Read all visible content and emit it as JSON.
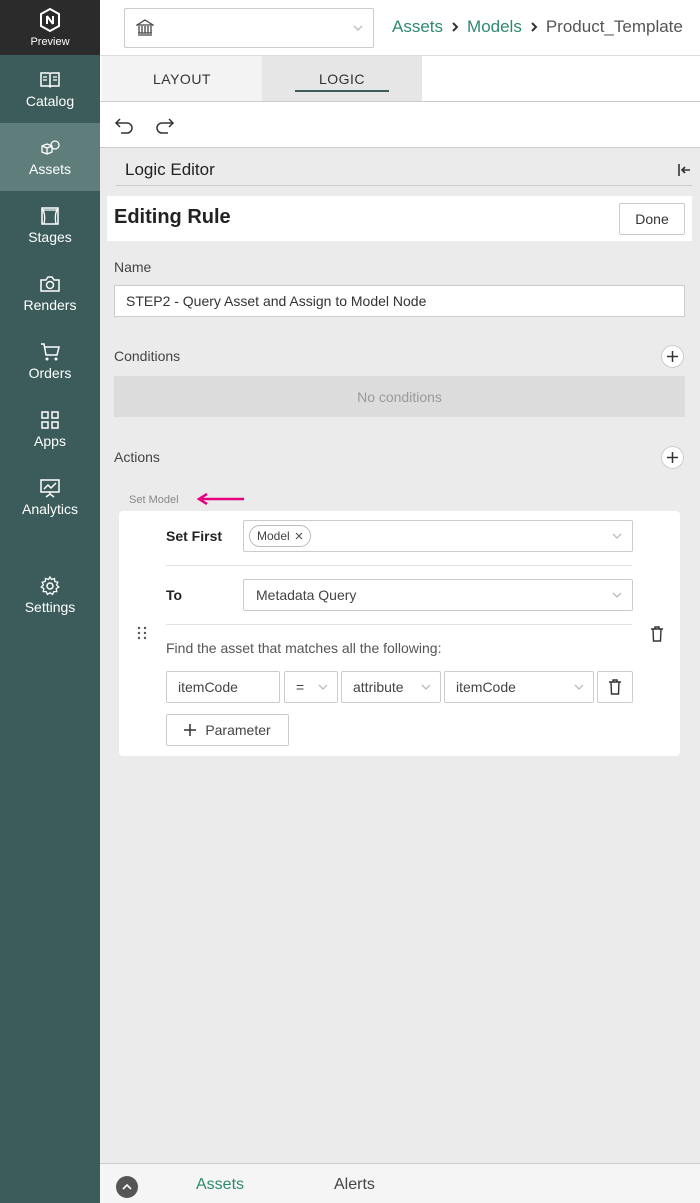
{
  "sidebar": {
    "logo_label": "Preview",
    "items": [
      {
        "label": "Catalog",
        "icon": "book-icon"
      },
      {
        "label": "Assets",
        "icon": "cubes-icon"
      },
      {
        "label": "Stages",
        "icon": "stage-icon"
      },
      {
        "label": "Renders",
        "icon": "camera-icon"
      },
      {
        "label": "Orders",
        "icon": "cart-icon"
      },
      {
        "label": "Apps",
        "icon": "grid-icon"
      },
      {
        "label": "Analytics",
        "icon": "chart-icon"
      }
    ],
    "settings": {
      "label": "Settings",
      "icon": "gear-icon"
    },
    "active": "Assets"
  },
  "header": {
    "asset_select_value": "",
    "breadcrumb": [
      "Assets",
      "Models",
      "Product_Template"
    ]
  },
  "tabs": [
    {
      "label": "LAYOUT"
    },
    {
      "label": "LOGIC"
    }
  ],
  "active_tab": "LOGIC",
  "editor": {
    "title": "Logic Editor",
    "rule_title": "Editing Rule",
    "done_label": "Done",
    "name_label": "Name",
    "name_value": "STEP2 - Query Asset and Assign to Model Node",
    "conditions_label": "Conditions",
    "no_conditions": "No conditions",
    "actions_label": "Actions",
    "action": {
      "type_label": "Set Model",
      "set_first_label": "Set First",
      "set_first_chip": "Model",
      "to_label": "To",
      "to_value": "Metadata Query",
      "find_text": "Find the asset that matches all the following:",
      "param": {
        "field": "itemCode",
        "operator": "=",
        "source": "attribute",
        "value": "itemCode"
      },
      "add_param_label": "Parameter"
    }
  },
  "bottom": {
    "tabs": [
      "Assets",
      "Alerts"
    ],
    "active": "Assets"
  },
  "colors": {
    "sidebar": "#3b5c5a",
    "accent": "#2e8a6f",
    "annotation_arrow": "#e6007e"
  }
}
